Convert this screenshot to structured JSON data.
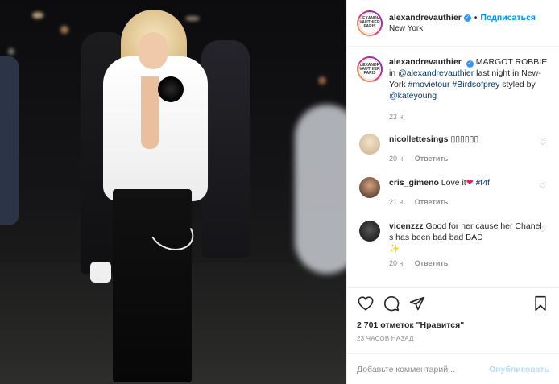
{
  "header": {
    "username": "alexandrevauthier",
    "verified_icon": "verified-badge-icon",
    "separator": "•",
    "follow_label": "Подписаться",
    "location": "New York",
    "avatar_text": "ALEXANDRE VAUTHIER PARIS"
  },
  "caption": {
    "username": "alexandrevauthier",
    "text_1": "MARGOT ROBBIE in ",
    "mention_1": "@alexandrevauthier",
    "text_2": " last night in New-York ",
    "tag_1": "#movietour",
    "tag_2": "#Birdsofprey",
    "text_3": " styled by ",
    "mention_2": "@kateyoung",
    "time": "23 ч."
  },
  "comments": [
    {
      "username": "nicollettesings",
      "text": "▯▯▯▯▯▯",
      "time": "20 ч.",
      "reply_label": "Ответить"
    },
    {
      "username": "cris_gimeno",
      "text": "Love it",
      "emoji": "❤",
      "tag": "#f4f",
      "time": "21 ч.",
      "reply_label": "Ответить"
    },
    {
      "username": "vicenzzz",
      "text": "Good for her cause her Chanel s has been bad bad BAD",
      "emoji": "✨",
      "time": "20 ч.",
      "reply_label": "Ответить"
    }
  ],
  "actions": {
    "likes": "2 701 отметок \"Нравится\"",
    "timestamp": "23 ЧАСОВ НАЗАД"
  },
  "add_comment": {
    "placeholder": "Добавьте комментарий...",
    "post_label": "Опубликовать"
  },
  "colors": {
    "accent": "#0095f6",
    "post_disabled": "#b2dffc",
    "muted": "#8e8e8e",
    "heart_emoji": "#e0245e"
  }
}
